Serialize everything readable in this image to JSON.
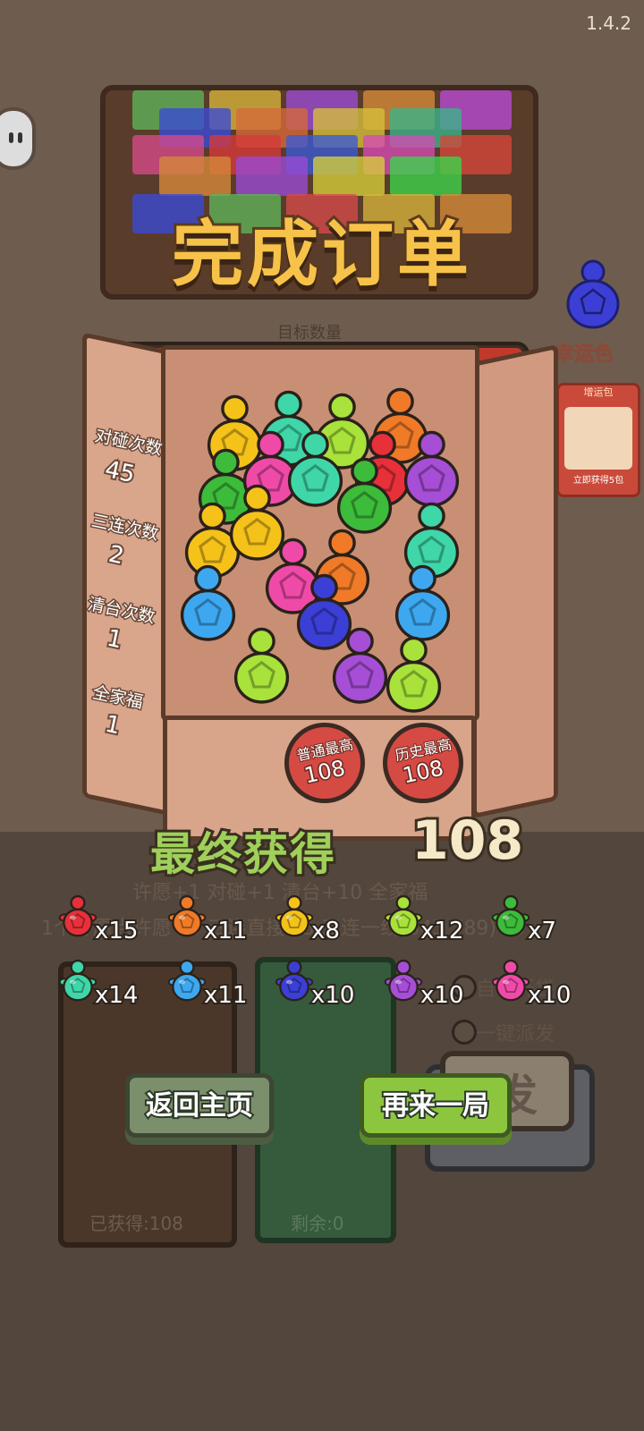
{
  "version": "1.4.2",
  "title": "完成订单",
  "target_label": "目标数量",
  "progress": 1.0,
  "lucky": {
    "label": "幸运色",
    "color": "#3b3fd6"
  },
  "reward_card": {
    "top": "增运包",
    "bottom": "立即获得5包"
  },
  "stats": [
    {
      "label": "对碰次数",
      "value": "45"
    },
    {
      "label": "三连次数",
      "value": "2"
    },
    {
      "label": "清台次数",
      "value": "1"
    },
    {
      "label": "全家福",
      "value": "1"
    }
  ],
  "badges": [
    {
      "label": "普通最高",
      "value": "108"
    },
    {
      "label": "历史最高",
      "value": "108"
    }
  ],
  "final": {
    "label": "最终获得",
    "value": "108"
  },
  "background_rules": {
    "line1": "许愿+1 对碰+1 清台+10 全家福",
    "line2": "1个许愿点许愿+3 三连直接+5 三连一线(345 789)+5"
  },
  "counts": [
    {
      "color": "#e8303a",
      "text": "x15"
    },
    {
      "color": "#f07a28",
      "text": "x11"
    },
    {
      "color": "#f5c21a",
      "text": "x8"
    },
    {
      "color": "#a8e23a",
      "text": "x12"
    },
    {
      "color": "#3dbb3a",
      "text": "x7"
    },
    {
      "color": "#3fd6a8",
      "text": "x14"
    },
    {
      "color": "#3da8f0",
      "text": "x11"
    },
    {
      "color": "#3b3fd6",
      "text": "x10"
    },
    {
      "color": "#a64ed6",
      "text": "x10"
    },
    {
      "color": "#f04aa8",
      "text": "x10"
    }
  ],
  "options": {
    "auto_open": "自动开袋",
    "one_click": "一键派发"
  },
  "send_label": "派发",
  "got_label": "已获得:108",
  "remain_label": "剩余:0",
  "buttons": {
    "home": "返回主页",
    "again": "再来一局"
  }
}
